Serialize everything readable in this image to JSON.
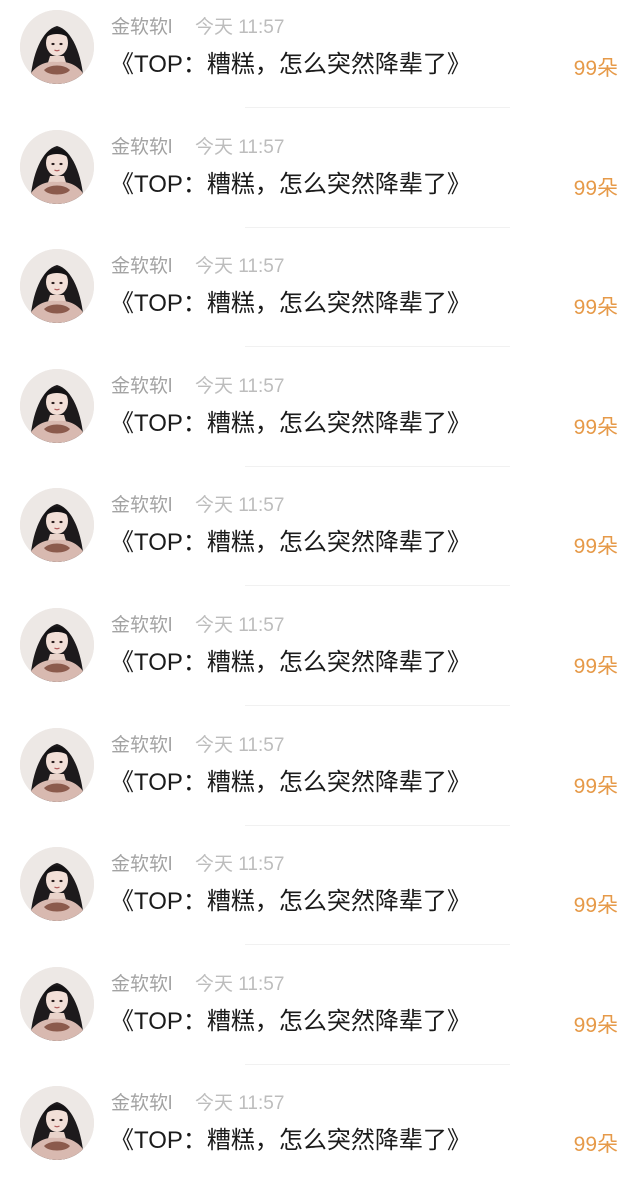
{
  "comments": [
    {
      "author": "金软软l",
      "time": "今天 11:57",
      "text": "《TOP：糟糕，怎么突然降辈了》",
      "flowers": "99朵"
    },
    {
      "author": "金软软l",
      "time": "今天 11:57",
      "text": "《TOP：糟糕，怎么突然降辈了》",
      "flowers": "99朵"
    },
    {
      "author": "金软软l",
      "time": "今天 11:57",
      "text": "《TOP：糟糕，怎么突然降辈了》",
      "flowers": "99朵"
    },
    {
      "author": "金软软l",
      "time": "今天 11:57",
      "text": "《TOP：糟糕，怎么突然降辈了》",
      "flowers": "99朵"
    },
    {
      "author": "金软软l",
      "time": "今天 11:57",
      "text": "《TOP：糟糕，怎么突然降辈了》",
      "flowers": "99朵"
    },
    {
      "author": "金软软l",
      "time": "今天 11:57",
      "text": "《TOP：糟糕，怎么突然降辈了》",
      "flowers": "99朵"
    },
    {
      "author": "金软软l",
      "time": "今天 11:57",
      "text": "《TOP：糟糕，怎么突然降辈了》",
      "flowers": "99朵"
    },
    {
      "author": "金软软l",
      "time": "今天 11:57",
      "text": "《TOP：糟糕，怎么突然降辈了》",
      "flowers": "99朵"
    },
    {
      "author": "金软软l",
      "time": "今天 11:57",
      "text": "《TOP：糟糕，怎么突然降辈了》",
      "flowers": "99朵"
    },
    {
      "author": "金软软l",
      "time": "今天 11:57",
      "text": "《TOP：糟糕，怎么突然降辈了》",
      "flowers": "99朵"
    }
  ],
  "colors": {
    "author": "#a3a3a3",
    "time": "#bdbdbd",
    "text": "#1b1b1b",
    "flowers": "#e69a49",
    "divider": "#f1f1f1"
  }
}
